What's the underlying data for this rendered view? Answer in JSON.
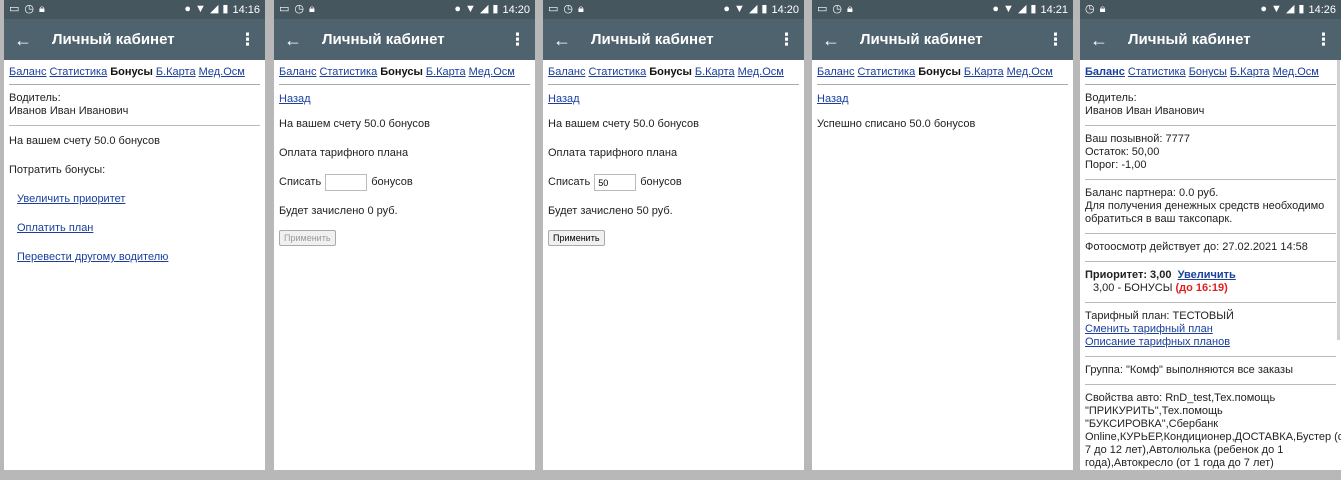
{
  "status": {
    "icons": [
      "image-icon",
      "clock-icon",
      "lock-icon"
    ],
    "icons_right": [
      "location-icon",
      "wifi-icon",
      "signal-icon",
      "battery-icon"
    ],
    "times": [
      "14:16",
      "14:20",
      "14:20",
      "14:21",
      "14:26"
    ]
  },
  "appbar": {
    "title": "Личный кабинет"
  },
  "nav": [
    "Баланс",
    "Статистика",
    "Бонусы",
    "Б.Карта",
    "Мед.Осм"
  ],
  "common": {
    "back_link": "Назад",
    "balance_text": "На вашем счету 50.0 бонусов",
    "tariff_payment": "Оплата тарифного плана",
    "write_off": "Списать",
    "bonuses": "бонусов",
    "apply": "Применить"
  },
  "screen1": {
    "driver_label": "Водитель:",
    "driver_name": "Иванов Иван Иванович",
    "balance": "На вашем счету 50.0 бонусов",
    "spend_label": "Потратить бонусы:",
    "links": [
      "Увеличить приоритет",
      "Оплатить план",
      "Перевести другому водителю"
    ]
  },
  "screen2": {
    "credit": "Будет зачислено 0 руб.",
    "input_value": ""
  },
  "screen3": {
    "credit": "Будет зачислено 50 руб.",
    "input_value": "50"
  },
  "screen4": {
    "result": "Успешно списано 50.0 бонусов"
  },
  "screen5": {
    "driver_label": "Водитель:",
    "driver_name": "Иванов Иван Иванович",
    "callsign": "Ваш позывной: 7777",
    "remainder": "Остаток: 50,00",
    "threshold": "Порог: -1,00",
    "partner_balance": "Баланс партнера: 0.0 руб.",
    "partner_note": "Для получения денежных средств необходимо обратиться в ваш таксопарк.",
    "photo_check": "Фотоосмотр действует до: 27.02.2021 14:58",
    "priority": "Приоритет: 3,00",
    "increase": "Увеличить",
    "priority_bonus": "3,00 - БОНУСЫ",
    "priority_until": "(до 16:19)",
    "tariff": "Тарифный план: ТЕСТОВЫЙ",
    "change_tariff": "Сменить тарифный план",
    "tariff_desc": "Описание тарифных планов",
    "group": "Группа: \"Комф\" выполняются все заказы",
    "car_props": "Свойства авто: RnD_test,Тех.помощь \"ПРИКУРИТЬ\",Тех.помощь \"БУКСИРОВКА\",Сбербанк Online,КУРЬЕР,Кондиционер,ДОСТАВКА,Бустер (от 7 до 12 лет),Автолюлька (ребенок до 1 года),Автокресло (от 1 года до 7 лет)"
  }
}
